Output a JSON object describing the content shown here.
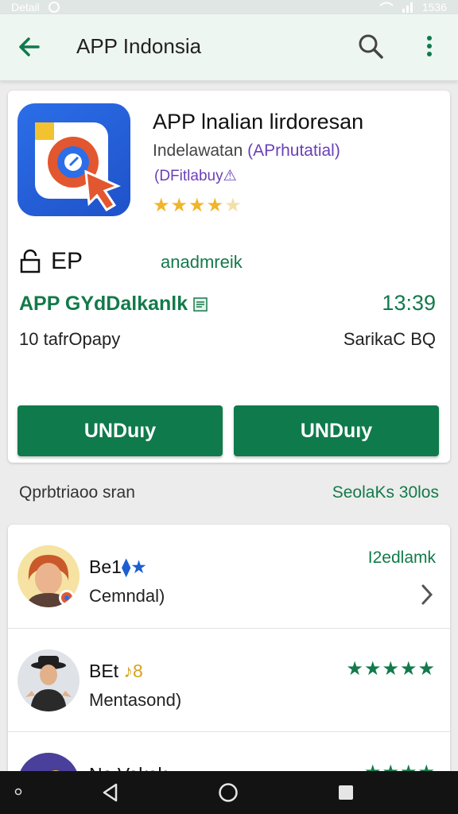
{
  "status_bar": {
    "left_text": "Detail",
    "right_text": "1536"
  },
  "app_bar": {
    "title": "APP Indonsia"
  },
  "app": {
    "title": "APP lnalian lirdoresan",
    "developer": "Indelawatan",
    "developer_accent": "(APrhutatial)",
    "category": "(DFitlabuy⚠",
    "rating_full": "★★★★",
    "rating_faint": "★",
    "ep_label": "EP",
    "admin_label": "anadmreik",
    "green_title": "APP GYdDalkanlk",
    "time": "13:39",
    "info_left": "10 tafrOpapy",
    "info_right": "SarikaC BQ",
    "button_left": "UNDuıy",
    "button_right": "UNDuıy"
  },
  "section": {
    "title": "Qprbtriaoo sran",
    "link": "SeolaKs 30los"
  },
  "reviews": [
    {
      "name": "Be1",
      "name_marks": "⧫★",
      "text": "Cemndal)",
      "meta": "I2edlamk"
    },
    {
      "name": "BEt",
      "name_marks": "♪8",
      "text": "Mentasond)",
      "stars": "★★★★★"
    },
    {
      "name": "No Vakak",
      "stars": "★★★★"
    }
  ],
  "colors": {
    "primary_green": "#0f7a4b",
    "app_bar_bg": "#eef6f1",
    "star_gold": "#f1b52b",
    "accent_purple": "#6a3fb8"
  }
}
